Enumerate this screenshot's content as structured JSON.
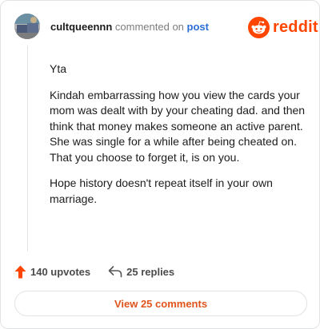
{
  "header": {
    "username": "cultqueennn",
    "action_text": "commented on",
    "post_link": "post",
    "brand": "reddit"
  },
  "comment": {
    "paragraphs": [
      "Yta",
      "Kindah embarrassing how you view the cards your mom was dealt with by your cheating dad. and then think that money makes someone an active parent. She was single for a while after being cheated on. That you choose to forget it, is on you.",
      "Hope history doesn't repeat itself in your own marriage."
    ]
  },
  "actions": {
    "upvotes": "140 upvotes",
    "replies": "25 replies"
  },
  "footer": {
    "view_comments": "View 25 comments"
  },
  "colors": {
    "brand": "#ff4500",
    "upvote": "#ff4500",
    "link": "#2b6fd6",
    "view_button_text": "#e0531c"
  },
  "icons": [
    "avatar",
    "reddit-snoo-icon",
    "upvote-arrow-icon",
    "reply-arrow-icon"
  ]
}
